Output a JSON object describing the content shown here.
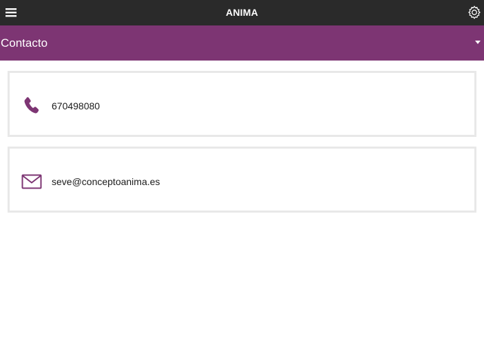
{
  "header": {
    "app_title": "ANIMA",
    "menu_icon": "hamburger-menu-icon",
    "settings_icon": "gear-icon"
  },
  "section": {
    "title": "Contacto",
    "dropdown_icon": "caret-down-icon",
    "color": "#7d3573"
  },
  "contacts": [
    {
      "type": "phone",
      "icon": "phone-icon",
      "value": "670498080"
    },
    {
      "type": "email",
      "icon": "envelope-icon",
      "value": "seve@conceptoanima.es"
    }
  ],
  "colors": {
    "topbar": "#2a2a2a",
    "accent": "#7d3573",
    "card_border": "#e8e8e8"
  }
}
